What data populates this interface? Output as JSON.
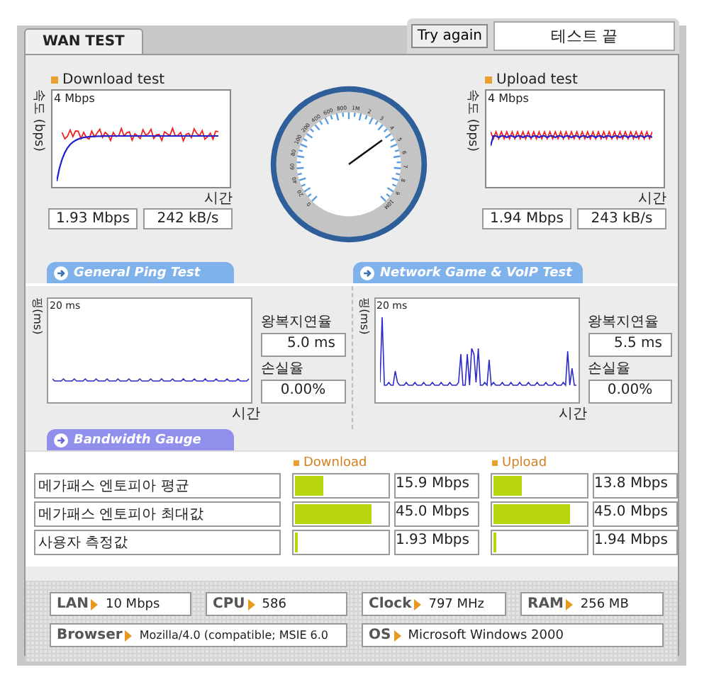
{
  "tab": {
    "label": "WAN TEST",
    "selected": true
  },
  "try_again": "Try again",
  "status": "테스트 끝",
  "speed_tests": [
    {
      "kind": "download",
      "title": "Download test",
      "y_axis": "속도 (bps)",
      "scale": "4 Mbps",
      "x_axis": "시간",
      "rate": "1.93 Mbps",
      "bytes": "242 kB/s"
    },
    {
      "kind": "upload",
      "title": "Upload test",
      "y_axis": "속도 (bps)",
      "scale": "4 Mbps",
      "x_axis": "시간",
      "rate": "1.94 Mbps",
      "bytes": "243 kB/s"
    }
  ],
  "gauge": {
    "labels": [
      "0",
      "20",
      "40",
      "60",
      "80",
      "100",
      "200",
      "400",
      "600",
      "800",
      "1M",
      "2",
      "3",
      "4",
      "5",
      "6",
      "7",
      "8",
      "9",
      "10M"
    ],
    "level": 0.7
  },
  "ping_tests": [
    {
      "kind": "general",
      "title": "General Ping Test",
      "color": "#7fb2ea",
      "y_axis": "핑(ms)",
      "scale": "20 ms",
      "x_axis": "시간",
      "latency_label": "왕복지연율",
      "latency": "5.0 ms",
      "loss_label": "손실율",
      "loss": "0.00%"
    },
    {
      "kind": "game",
      "title": "Network Game & VoIP Test",
      "color": "#7fb2ea",
      "y_axis": "핑(ms)",
      "scale": "20 ms",
      "x_axis": "시간",
      "latency_label": "왕복지연율",
      "latency": "5.5 ms",
      "loss_label": "손실율",
      "loss": "0.00%"
    }
  ],
  "bandwidth": {
    "title": "Bandwidth Gauge",
    "color": "#9090ec",
    "columns": [
      "Download",
      "Upload"
    ],
    "rows": [
      {
        "label": "메가패스 엔토피아 평균",
        "download": {
          "level": 0.3,
          "value": "15.9 Mbps"
        },
        "upload": {
          "level": 0.3,
          "value": "13.8 Mbps"
        }
      },
      {
        "label": "메가패스 엔토피아 최대값",
        "download": {
          "level": 0.83,
          "value": "45.0 Mbps"
        },
        "upload": {
          "level": 0.83,
          "value": "45.0 Mbps"
        }
      },
      {
        "label": "사용자 측정값",
        "download": {
          "level": 0.03,
          "value": "1.93 Mbps"
        },
        "upload": {
          "level": 0.03,
          "value": "1.94 Mbps"
        }
      }
    ]
  },
  "system": [
    [
      {
        "label": "LAN",
        "value": "10 Mbps"
      },
      {
        "label": "CPU",
        "value": "586"
      },
      {
        "label": "Clock",
        "value": "797 MHz"
      },
      {
        "label": "RAM",
        "value": "256 MB"
      }
    ],
    [
      {
        "label": "Browser",
        "value": "Mozilla/4.0 (compatible; MSIE 6.0"
      },
      {
        "label": "OS",
        "value": "Microsoft Windows 2000"
      }
    ]
  ]
}
